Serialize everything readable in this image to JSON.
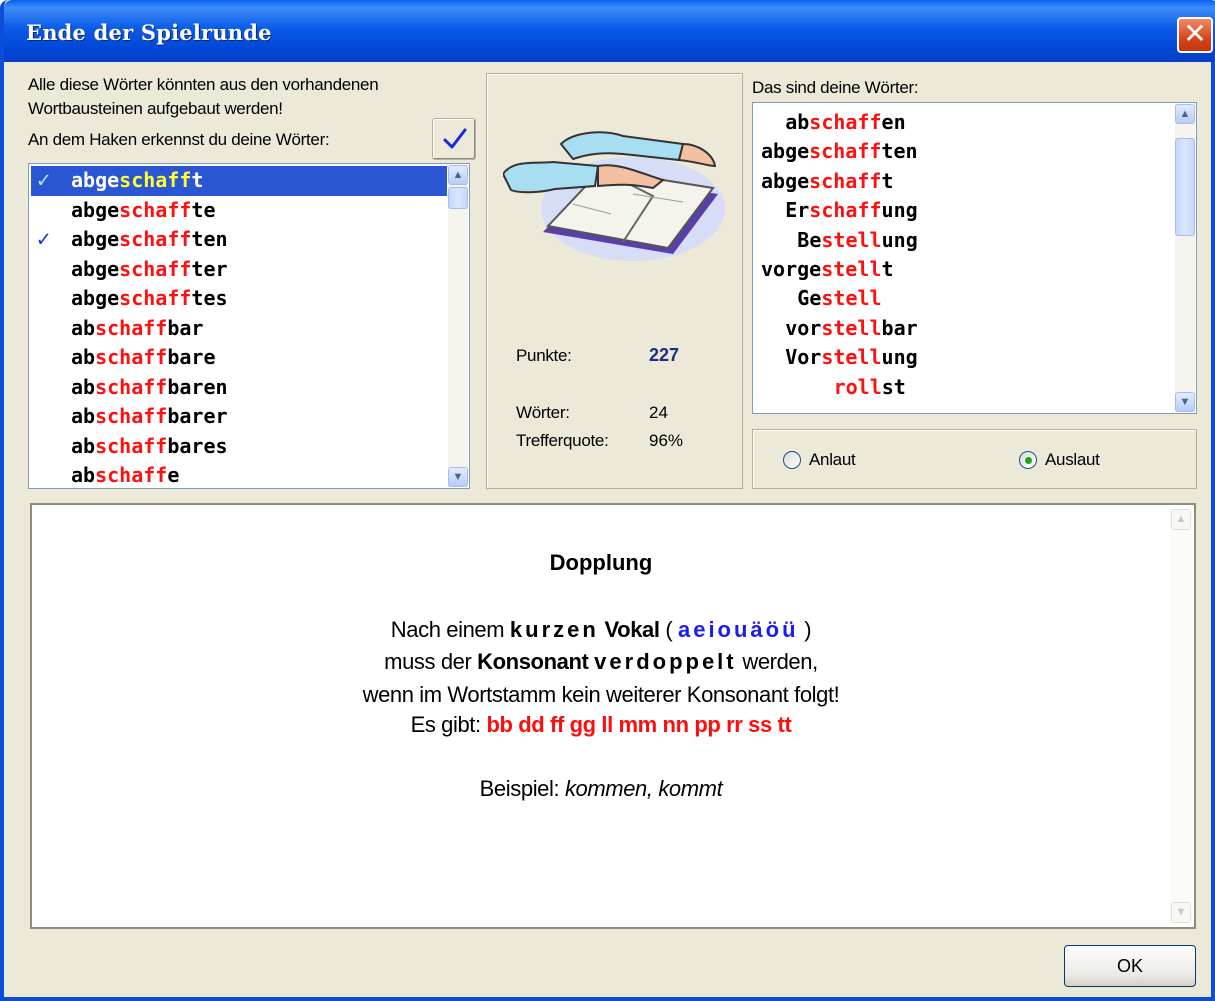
{
  "window": {
    "title": "Ende der Spielrunde",
    "close_glyph": "✕"
  },
  "left": {
    "info_line1": "Alle diese Wörter könnten aus den  vorhandenen",
    "info_line2": "Wortbausteinen aufgebaut werden!",
    "check_hint": "An dem Haken erkennst du  deine Wörter:",
    "check_icon": "checkmark-icon",
    "words": [
      {
        "pre": "abge",
        "stem": "schaff",
        "suf": "t",
        "checked": true,
        "selected": true
      },
      {
        "pre": "abge",
        "stem": "schaff",
        "suf": "te",
        "checked": false,
        "selected": false
      },
      {
        "pre": "abge",
        "stem": "schaff",
        "suf": "ten",
        "checked": true,
        "selected": false
      },
      {
        "pre": "abge",
        "stem": "schaff",
        "suf": "ter",
        "checked": false,
        "selected": false
      },
      {
        "pre": "abge",
        "stem": "schaff",
        "suf": "tes",
        "checked": false,
        "selected": false
      },
      {
        "pre": "ab",
        "stem": "schaff",
        "suf": "bar",
        "checked": false,
        "selected": false
      },
      {
        "pre": "ab",
        "stem": "schaff",
        "suf": "bare",
        "checked": false,
        "selected": false
      },
      {
        "pre": "ab",
        "stem": "schaff",
        "suf": "baren",
        "checked": false,
        "selected": false
      },
      {
        "pre": "ab",
        "stem": "schaff",
        "suf": "barer",
        "checked": false,
        "selected": false
      },
      {
        "pre": "ab",
        "stem": "schaff",
        "suf": "bares",
        "checked": false,
        "selected": false
      },
      {
        "pre": "ab",
        "stem": "schaff",
        "suf": "e",
        "checked": false,
        "selected": false
      }
    ],
    "check_glyph": "✓"
  },
  "center": {
    "image": "reading-book-icon",
    "points_label": "Punkte:",
    "points_value": "227",
    "words_label": "Wörter:",
    "words_value": "24",
    "hitrate_label": "Trefferquote:",
    "hitrate_value": "96%"
  },
  "right": {
    "title": "Das sind deine Wörter:",
    "words": [
      {
        "indent": 2,
        "pre": "ab",
        "stem": "schaff",
        "suf": "en"
      },
      {
        "indent": 0,
        "pre": "abge",
        "stem": "schaff",
        "suf": "ten"
      },
      {
        "indent": 0,
        "pre": "abge",
        "stem": "schaff",
        "suf": "t"
      },
      {
        "indent": 2,
        "pre": "Er",
        "stem": "schaff",
        "suf": "ung"
      },
      {
        "indent": 3,
        "pre": "Be",
        "stem": "stell",
        "suf": "ung"
      },
      {
        "indent": 0,
        "pre": "vorge",
        "stem": "stell",
        "suf": "t"
      },
      {
        "indent": 3,
        "pre": "Ge",
        "stem": "stell",
        "suf": ""
      },
      {
        "indent": 2,
        "pre": "vor",
        "stem": "stell",
        "suf": "bar"
      },
      {
        "indent": 2,
        "pre": "Vor",
        "stem": "stell",
        "suf": "ung"
      },
      {
        "indent": 6,
        "pre": "",
        "stem": "roll",
        "suf": "st"
      }
    ],
    "radio_anlaut": "Anlaut",
    "radio_auslaut": "Auslaut",
    "selected_radio": "Auslaut"
  },
  "info": {
    "title": "Dopplung",
    "l1_a": "Nach einem ",
    "l1_b": "kurzen",
    "l1_c": " Vokal",
    "l1_d": " ( ",
    "l1_vowels": "aeiouäöü",
    "l1_e": " )",
    "l2_a": "muss der ",
    "l2_b": "Konsonant",
    "l2_c": " ",
    "l2_d": "verdoppelt",
    "l2_e": " werden,",
    "l3": "wenn im Wortstamm kein weiterer Konsonant folgt!",
    "l4_a": "Es gibt:  ",
    "l4_b": "bb dd ff gg ll mm nn pp rr ss tt",
    "l5_a": "Beispiel: ",
    "l5_b": "kommen, kommt"
  },
  "buttons": {
    "ok": "OK"
  },
  "colors": {
    "stem": "#ff1010",
    "selection": "#2a56d4",
    "vowels": "#1c1cf0",
    "titlebar": "#0b5ce8"
  }
}
